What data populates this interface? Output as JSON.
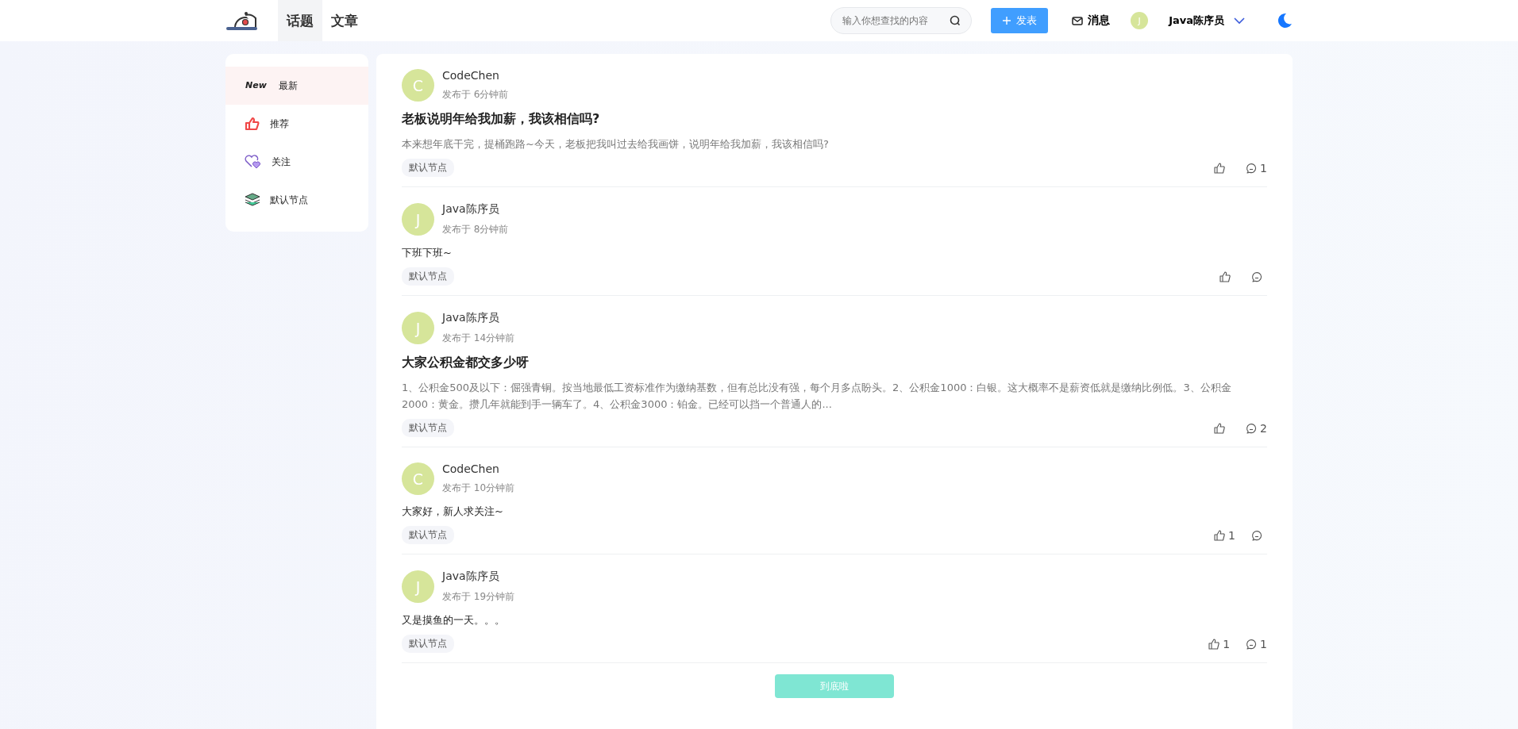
{
  "nav": {
    "tabs": [
      {
        "label": "话题",
        "selected": true
      },
      {
        "label": "文章",
        "selected": false
      }
    ],
    "search": {
      "placeholder": "输入你想查找的内容"
    },
    "publish": "发表",
    "messages": "消息",
    "user": {
      "avatar": "J",
      "name": "Java陈序员"
    }
  },
  "sidebar": {
    "items": [
      {
        "kind": "new",
        "icon_text": "New",
        "label": "最新",
        "selected": true
      },
      {
        "kind": "thumb",
        "label": "推荐",
        "selected": false
      },
      {
        "kind": "heart",
        "label": "关注",
        "selected": false
      },
      {
        "kind": "stack",
        "label": "默认节点",
        "selected": false
      }
    ]
  },
  "posts": [
    {
      "avatar": "C",
      "author": "CodeChen",
      "time": "发布于 6分钟前",
      "title": "老板说明年给我加薪，我该相信吗?",
      "body": "本来想年底干完，提桶跑路~今天，老板把我叫过去给我画饼，说明年给我加薪，我该相信吗?",
      "tag": "默认节点",
      "comments": "1"
    },
    {
      "avatar": "J",
      "author": "Java陈序员",
      "time": "发布于 8分钟前",
      "body": "下班下班~",
      "tag": "默认节点"
    },
    {
      "avatar": "J",
      "author": "Java陈序员",
      "time": "发布于 14分钟前",
      "title": "大家公积金都交多少呀",
      "body": "1、公积金500及以下：倔强青铜。按当地最低工资标准作为缴纳基数，但有总比没有强，每个月多点盼头。2、公积金1000：白银。这大概率不是薪资低就是缴纳比例低。3、公积金2000：黄金。攒几年就能到手一辆车了。4、公积金3000：铂金。已经可以挡一个普通人的...",
      "tag": "默认节点",
      "comments": "2"
    },
    {
      "avatar": "C",
      "author": "CodeChen",
      "time": "发布于 10分钟前",
      "body": "大家好，新人求关注~",
      "tag": "默认节点",
      "likes": "1"
    },
    {
      "avatar": "J",
      "author": "Java陈序员",
      "time": "发布于 19分钟前",
      "body": "又是摸鱼的一天。。。",
      "tag": "默认节点",
      "likes": "1",
      "comments": "1"
    }
  ],
  "end_button": "到底啦"
}
